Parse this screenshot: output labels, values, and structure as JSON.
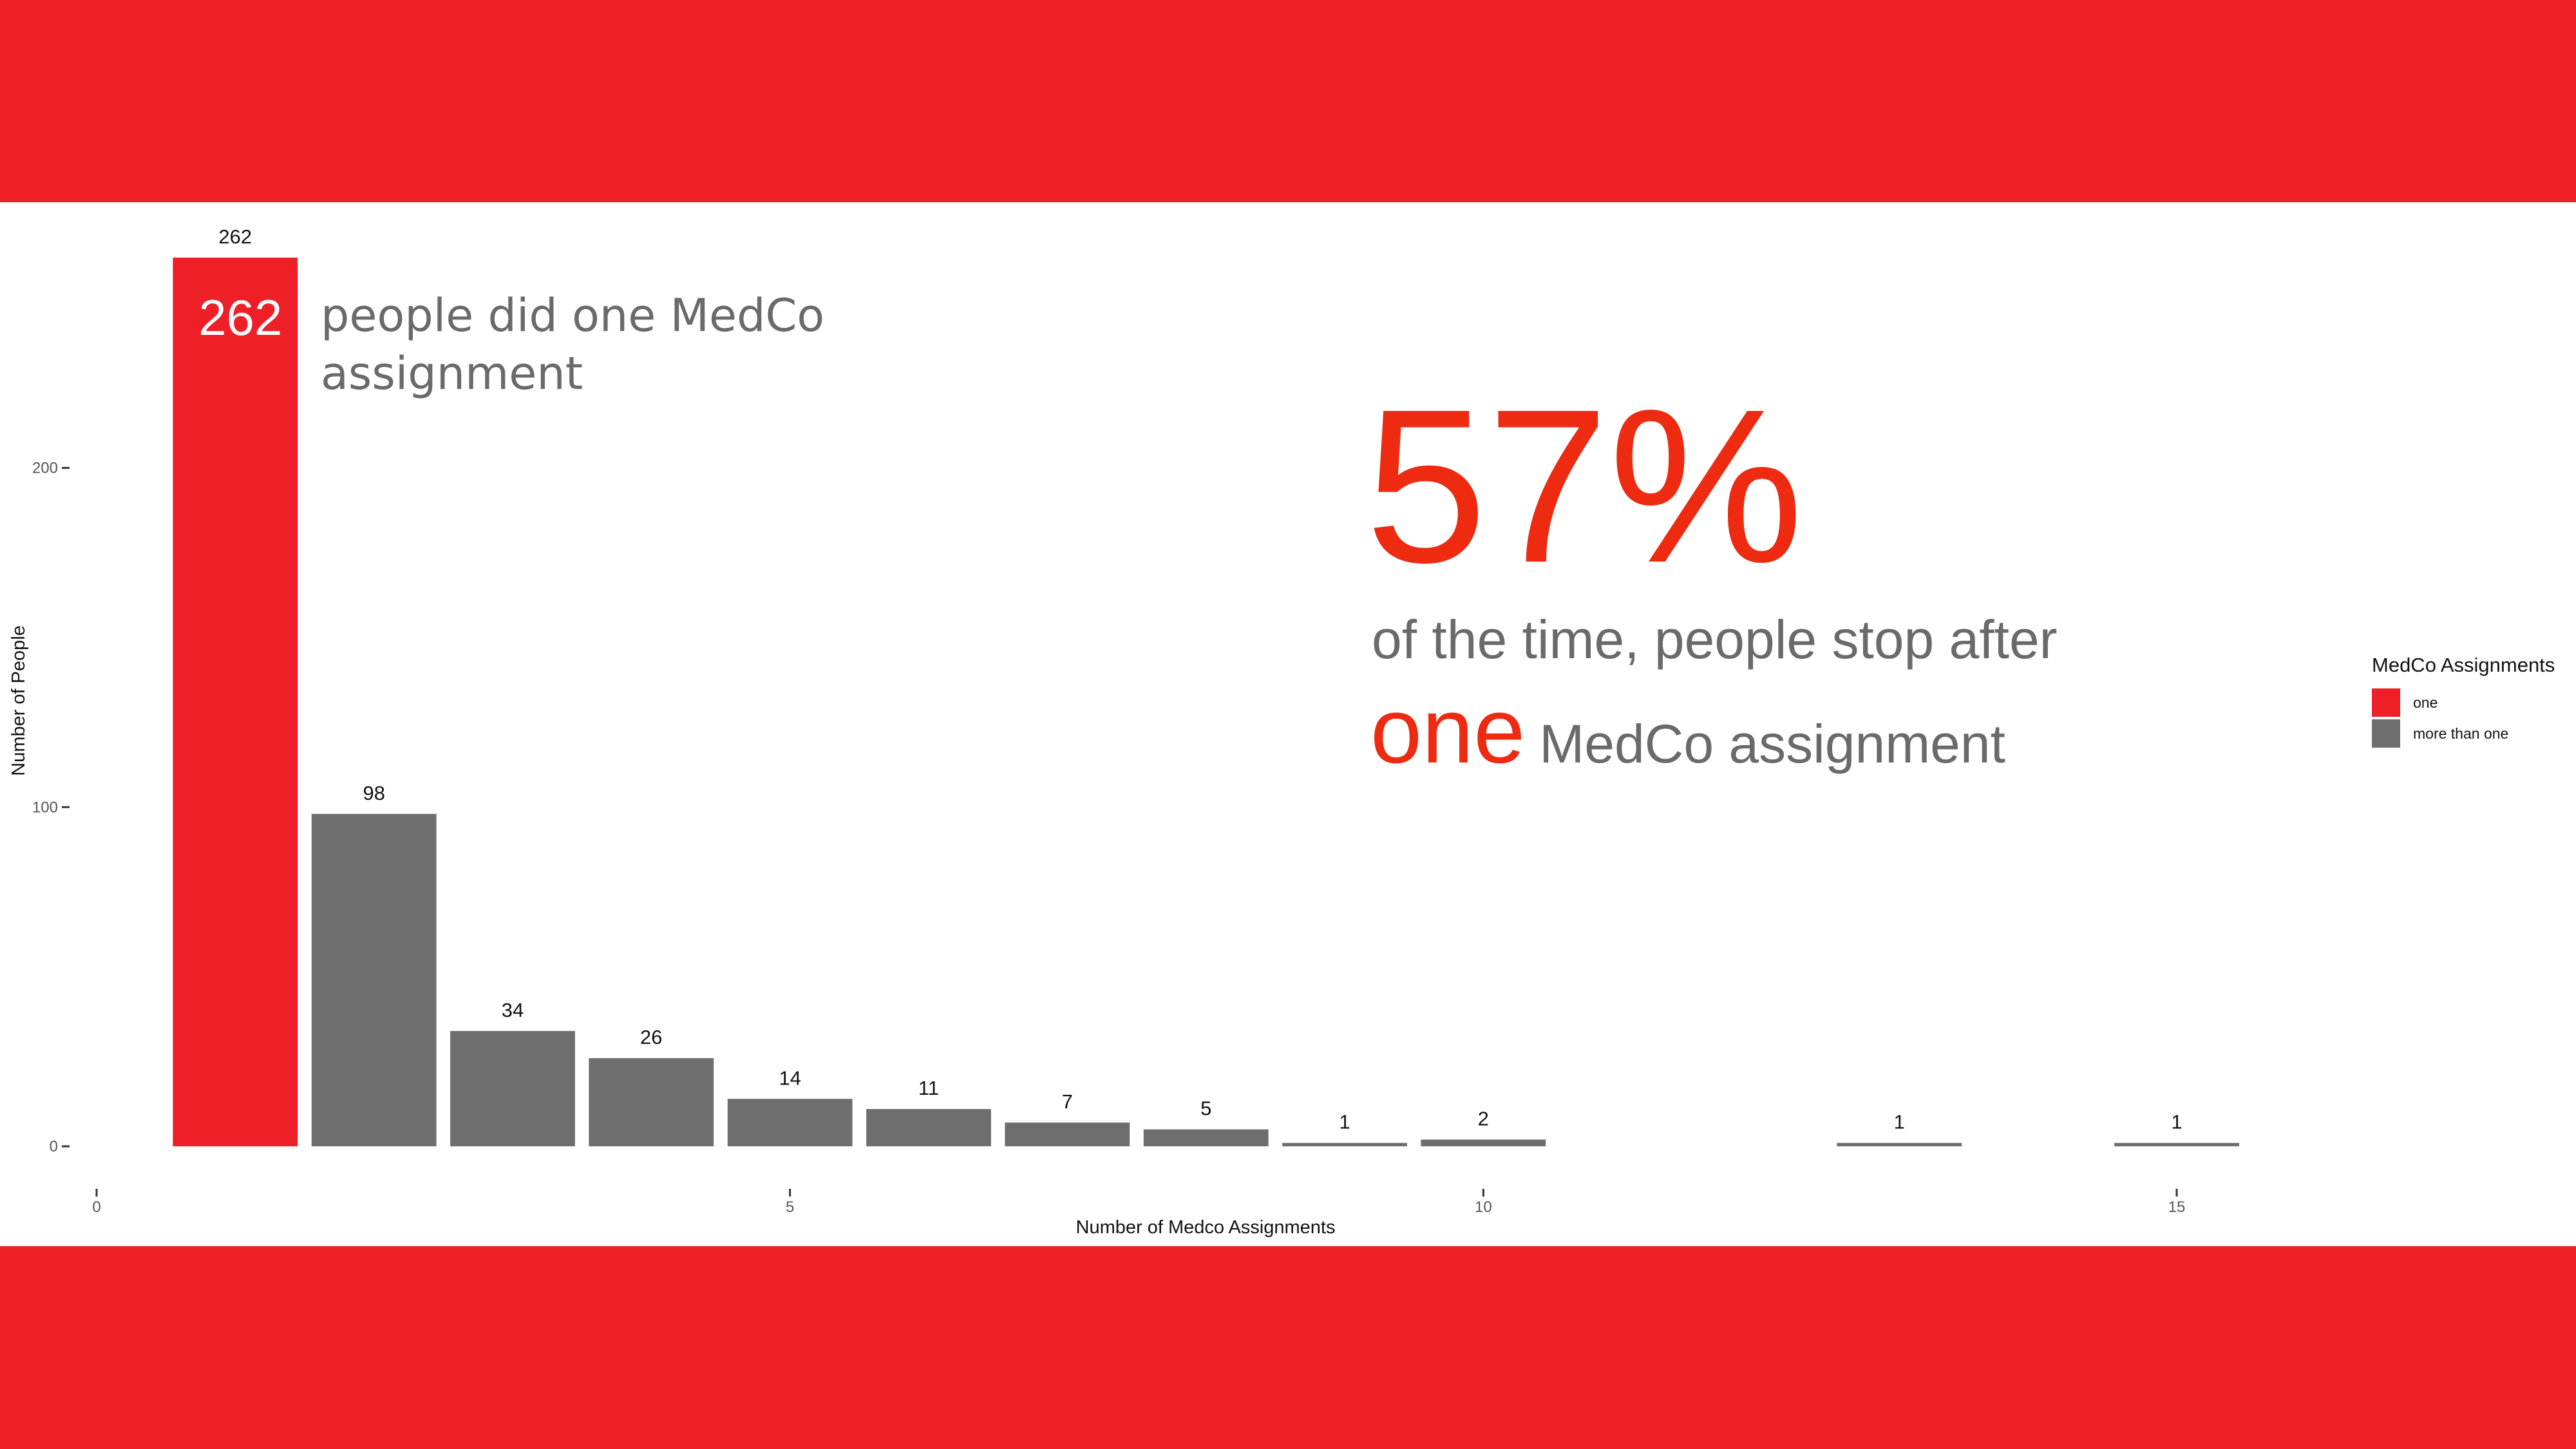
{
  "colors": {
    "band": "#ee1f26",
    "one": "#ee1f26",
    "more_than_one": "#6e6e6e",
    "accent_text": "#ee2a10",
    "grey_text": "#6a6a6a",
    "white": "#ffffff"
  },
  "callout": {
    "bar_value": "262",
    "text": "people did one MedCo assignment"
  },
  "stat": {
    "percent": "57%",
    "line1": "of the time, people stop after",
    "highlight": "one",
    "line2_rest": "MedCo assignment"
  },
  "legend": {
    "title": "MedCo Assignments",
    "items": [
      {
        "label": "one",
        "color_key": "one"
      },
      {
        "label": "more than one",
        "color_key": "more_than_one"
      }
    ]
  },
  "chart_data": {
    "type": "bar",
    "xlabel": "Number of Medco Assignments",
    "ylabel": "Number of People",
    "xlim": [
      0,
      16
    ],
    "ylim": [
      0,
      262
    ],
    "x_ticks": [
      0,
      5,
      10,
      15
    ],
    "y_ticks": [
      0,
      100,
      200
    ],
    "grid": false,
    "legend_position": "right",
    "x": [
      1,
      2,
      3,
      4,
      5,
      6,
      7,
      8,
      9,
      10,
      13,
      15
    ],
    "values": [
      262,
      98,
      34,
      26,
      14,
      11,
      7,
      5,
      1,
      2,
      1,
      1
    ],
    "groups": [
      "one",
      "more than one",
      "more than one",
      "more than one",
      "more than one",
      "more than one",
      "more than one",
      "more than one",
      "more than one",
      "more than one",
      "more than one",
      "more than one"
    ]
  }
}
